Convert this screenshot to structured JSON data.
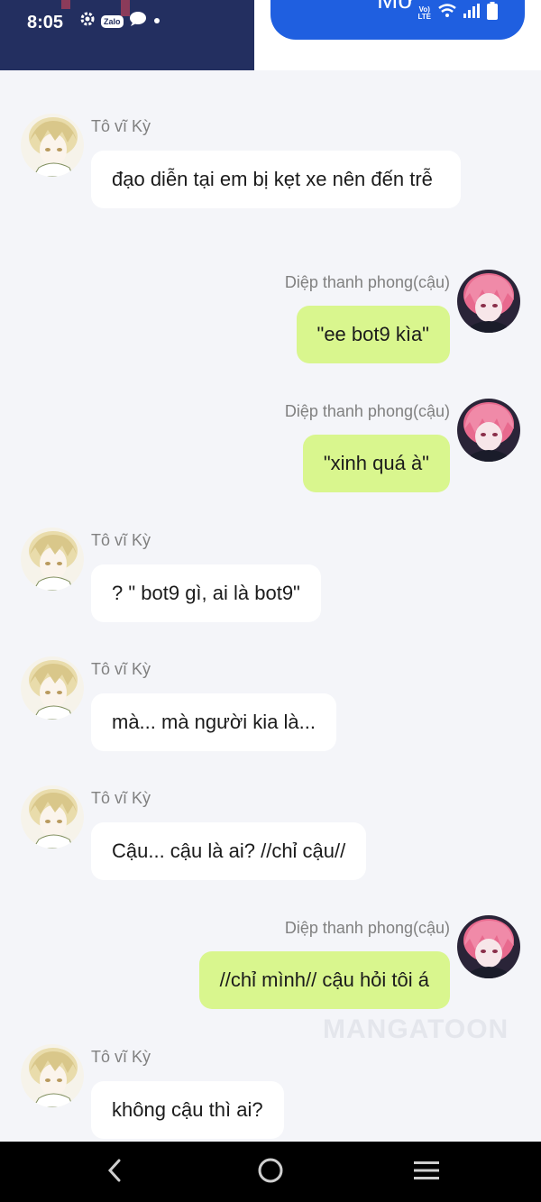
{
  "status_bar": {
    "time": "8:05",
    "zalo_label": "Zalo",
    "volte_line1": "Vo)",
    "volte_line2": "LTE"
  },
  "top_action": {
    "label": "Mở"
  },
  "names": {
    "left": "Tô vĩ Kỳ",
    "right": "Diệp thanh phong(cậu)"
  },
  "messages": [
    {
      "side": "left",
      "name": "Tô vĩ Kỳ",
      "text": "đạo diễn tại em bị kẹt xe nên đến trễ"
    },
    {
      "side": "right",
      "name": "Diệp thanh phong(cậu)",
      "text": "\"ee bot9 kìa\""
    },
    {
      "side": "right",
      "name": "Diệp thanh phong(cậu)",
      "text": "\"xinh quá à\""
    },
    {
      "side": "left",
      "name": "Tô vĩ Kỳ",
      "text": "? \" bot9 gì, ai là bot9\""
    },
    {
      "side": "left",
      "name": "Tô vĩ Kỳ",
      "text": "mà... mà người kia là..."
    },
    {
      "side": "left",
      "name": "Tô vĩ Kỳ",
      "text": "Cậu... cậu là ai? //chỉ cậu//"
    },
    {
      "side": "right",
      "name": "Diệp thanh phong(cậu)",
      "text": "//chỉ mình// cậu hỏi tôi á"
    },
    {
      "side": "left",
      "name": "Tô vĩ Kỳ",
      "text": "không cậu thì ai?"
    }
  ],
  "watermark": "MANGATOON",
  "icons": {
    "settings": "gear-icon",
    "chat": "chat-bubble-icon",
    "wifi": "wifi-icon",
    "signal": "signal-icon",
    "battery": "battery-icon",
    "back": "back-chevron-icon",
    "home": "home-circle-icon",
    "menu": "menu-lines-icon"
  },
  "colors": {
    "status_bg": "#232f60",
    "pill_bg": "#1f5fe0",
    "bubble_right": "#d9f68e",
    "bubble_left": "#ffffff",
    "background": "#f4f5f9",
    "name_text": "#808080"
  }
}
